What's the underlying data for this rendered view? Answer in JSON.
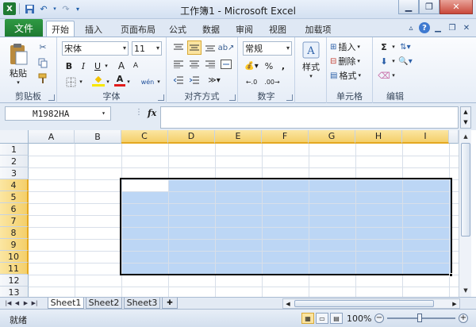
{
  "window": {
    "title": "工作簿1 - Microsoft Excel"
  },
  "tabs": {
    "file": "文件",
    "items": [
      "开始",
      "插入",
      "页面布局",
      "公式",
      "数据",
      "审阅",
      "视图",
      "加载项"
    ],
    "active": "开始"
  },
  "ribbon": {
    "clipboard": {
      "label": "剪贴板",
      "paste": "粘贴"
    },
    "font": {
      "label": "字体",
      "name": "宋体",
      "size": "11",
      "bold": "B",
      "italic": "I",
      "underline": "U",
      "grow": "A",
      "shrink": "A",
      "fill": "◆",
      "color": "A",
      "phonetic": "wén"
    },
    "alignment": {
      "label": "对齐方式"
    },
    "number": {
      "label": "数字",
      "format": "常规",
      "percent": "%",
      "comma": ","
    },
    "styles": {
      "label": "样式",
      "styles": "样式"
    },
    "cells": {
      "label": "单元格",
      "insert": "插入",
      "delete": "删除",
      "format": "格式"
    },
    "editing": {
      "label": "编辑",
      "sum": "Σ"
    }
  },
  "formula_bar": {
    "name_box": "M1982HA",
    "fx": "fx",
    "formula": ""
  },
  "grid": {
    "columns": [
      "A",
      "B",
      "C",
      "D",
      "E",
      "F",
      "G",
      "H",
      "I"
    ],
    "rows": [
      "1",
      "2",
      "3",
      "4",
      "5",
      "6",
      "7",
      "8",
      "9",
      "10",
      "11",
      "12",
      "13"
    ],
    "selected_columns": [
      "C",
      "D",
      "E",
      "F",
      "G",
      "H",
      "I"
    ],
    "selected_rows": [
      "4",
      "5",
      "6",
      "7",
      "8",
      "9",
      "10",
      "11"
    ]
  },
  "sheets": {
    "items": [
      "Sheet1",
      "Sheet2",
      "Sheet3"
    ],
    "active": "Sheet1"
  },
  "status": {
    "text": "就绪",
    "zoom": "100%"
  },
  "colors": {
    "file_tab": "#1e7a31",
    "selection": "#bcd6f5",
    "header_selected": "#f4cf6a"
  }
}
